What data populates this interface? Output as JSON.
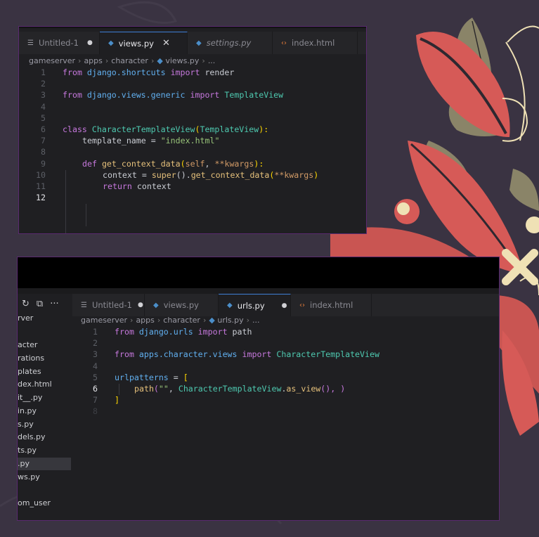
{
  "colors": {
    "background": "#3a3342",
    "editor": "#1f1f22",
    "accent_border": "#5a2a70",
    "leaf_red": "#d65a57",
    "leaf_olive": "#8a8468",
    "cream": "#efe1b5"
  },
  "editor_top": {
    "tabs": [
      {
        "label": "Untitled-1",
        "icon": "text-file-icon",
        "modified": "●"
      },
      {
        "label": "views.py",
        "icon": "python-file-icon",
        "close": "✕"
      },
      {
        "label": "settings.py",
        "icon": "python-file-icon"
      },
      {
        "label": "index.html",
        "icon": "html-file-icon"
      }
    ],
    "breadcrumb": [
      "gameserver",
      "apps",
      "character",
      "views.py",
      "..."
    ],
    "line_numbers": [
      "1",
      "2",
      "3",
      "4",
      "5",
      "6",
      "7",
      "8",
      "9",
      "10",
      "11",
      "12"
    ],
    "code": {
      "l1": {
        "kw1": "from",
        "mod": "django.shortcuts",
        "kw2": "import",
        "name": "render"
      },
      "l3": {
        "kw1": "from",
        "mod": "django.views.generic",
        "kw2": "import",
        "name": "TemplateView"
      },
      "l6": {
        "kw": "class",
        "cls": "CharacterTemplateView",
        "p1": "(",
        "base": "TemplateView",
        "p2": "):"
      },
      "l7": {
        "var": "template_name",
        "op": " = ",
        "str": "\"index.html\""
      },
      "l9": {
        "kw": "def",
        "fn": "get_context_data",
        "p1": "(",
        "self": "self",
        "comma": ", ",
        "kwargs": "**kwargs",
        "p2": "):"
      },
      "l10": {
        "var": "context",
        "op": " = ",
        "fn1": "super",
        "p1": "().",
        "fn2": "get_context_data",
        "p2": "(",
        "kwargs": "**kwargs",
        "p3": ")"
      },
      "l11": {
        "kw": "return",
        "var": "context"
      }
    }
  },
  "editor_bottom": {
    "toolbar_icons": [
      "refresh-icon",
      "collapse-icon",
      "more-icon"
    ],
    "toolbar_glyphs": [
      "↻",
      "⧉",
      "···"
    ],
    "tabs": [
      {
        "label": "Untitled-1",
        "icon": "text-file-icon",
        "modified": "●"
      },
      {
        "label": "views.py",
        "icon": "python-file-icon"
      },
      {
        "label": "urls.py",
        "icon": "python-file-icon",
        "modified": "●"
      },
      {
        "label": "index.html",
        "icon": "html-file-icon"
      }
    ],
    "breadcrumb": [
      "gameserver",
      "apps",
      "character",
      "urls.py",
      "..."
    ],
    "sidebar_items": [
      "rver",
      "acter",
      "rations",
      "plates",
      "dex.html",
      "it__.py",
      "in.py",
      "s.py",
      "dels.py",
      "ts.py",
      ".py",
      "ws.py",
      "om_user"
    ],
    "line_numbers": [
      "1",
      "2",
      "3",
      "4",
      "5",
      "6",
      "7",
      "8"
    ],
    "code": {
      "l1": {
        "kw1": "from",
        "mod": "django.urls",
        "kw2": "import",
        "name": "path"
      },
      "l3": {
        "kw1": "from",
        "mod": "apps.character.views",
        "kw2": "import",
        "name": "CharacterTemplateView"
      },
      "l5": {
        "var": "urlpatterns",
        "op": " = ",
        "br": "["
      },
      "l6": {
        "fn": "path",
        "p1": "(",
        "str": "\"\"",
        "comma": ", ",
        "cls": "CharacterTemplateView",
        "dot": ".",
        "fn2": "as_view",
        "p2": "(), )"
      },
      "l7": {
        "br": "]"
      }
    }
  }
}
